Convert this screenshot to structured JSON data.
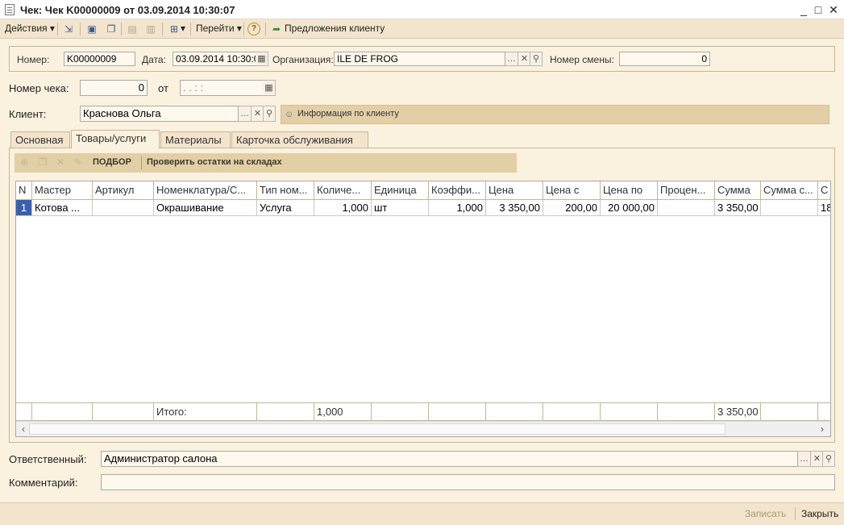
{
  "window": {
    "title": "Чек: Чек K00000009 от 03.09.2014 10:30:07",
    "minimize": "_",
    "maximize": "□",
    "close": "✕"
  },
  "toolbar": {
    "actions_label": "Действия",
    "goto_label": "Перейти",
    "help_label": "?",
    "offers_label": "Предложения клиенту"
  },
  "header": {
    "number_label": "Номер:",
    "number_value": "K00000009",
    "date_label": "Дата:",
    "date_value": "03.09.2014 10:30:07",
    "org_label": "Организация:",
    "org_value": "ILE DE FROG",
    "shift_label": "Номер смены:",
    "shift_value": "0"
  },
  "receipt": {
    "label": "Номер чека:",
    "value": "0",
    "from_label": "от",
    "date_placeholder": " .  .       :  :"
  },
  "client": {
    "label": "Клиент:",
    "value": "Краснова Ольга",
    "info_label": "Информация по клиенту"
  },
  "tabs": [
    {
      "label": "Основная"
    },
    {
      "label": "Товары/услуги"
    },
    {
      "label": "Материалы"
    },
    {
      "label": "Карточка обслуживания"
    }
  ],
  "subtoolbar": {
    "pick_label": "ПОДБОР",
    "check_label": "Проверить остатки на складах"
  },
  "table": {
    "columns": [
      "N",
      "Мастер",
      "Артикул",
      "Номенклатура/С...",
      "Тип ном...",
      "Количе...",
      "Единица",
      "Коэффи...",
      "Цена",
      "Цена с",
      "Цена по",
      "Процен...",
      "Сумма",
      "Сумма с...",
      "С"
    ],
    "rows": [
      [
        "1",
        "Котова ...",
        "",
        "Окрашивание",
        "Услуга",
        "1,000",
        "шт",
        "1,000",
        "3 350,00",
        "200,00",
        "20 000,00",
        "",
        "3 350,00",
        "",
        "18"
      ]
    ],
    "totals": [
      "",
      "",
      "",
      "Итого:",
      "",
      "1,000",
      "",
      "",
      "",
      "",
      "",
      "",
      "3 350,00",
      "",
      ""
    ]
  },
  "footer": {
    "responsible_label": "Ответственный:",
    "responsible_value": "Администратор салона",
    "comment_label": "Комментарий:",
    "comment_value": "",
    "save_label": "Записать",
    "close_label": "Закрыть"
  }
}
